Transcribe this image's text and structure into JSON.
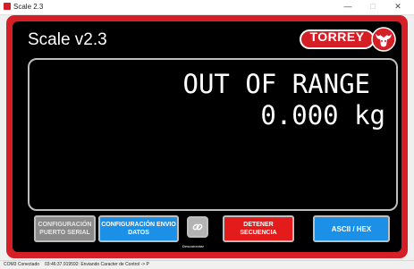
{
  "window": {
    "title": "Scale 2.3",
    "minimize": "—",
    "maximize": "□",
    "close": "✕"
  },
  "app": {
    "title": "Scale v2.3",
    "logo_text": "TORREY",
    "logo_icon": "bull-head-icon"
  },
  "display": {
    "status": "OUT OF RANGE",
    "weight": "0.000 kg"
  },
  "buttons": {
    "config_serial": "CONFIGURACIÓN PUERTO SERIAL",
    "config_envio": "CONFIGURACIÓN ENVIO DATOS",
    "disconnect_label": "Desconectar",
    "detener": "DETENER SECUENCIA",
    "ascii_hex": "ASCII / HEX"
  },
  "statusbar": {
    "connection": "COM3 Conectado",
    "message": "03:46:37.919592: Enviando Caracter de Control -> P"
  },
  "colors": {
    "brand_red": "#d51f26",
    "blue": "#1c8fe6",
    "stop_red": "#e41b1b",
    "gray": "#8a8a8a"
  }
}
